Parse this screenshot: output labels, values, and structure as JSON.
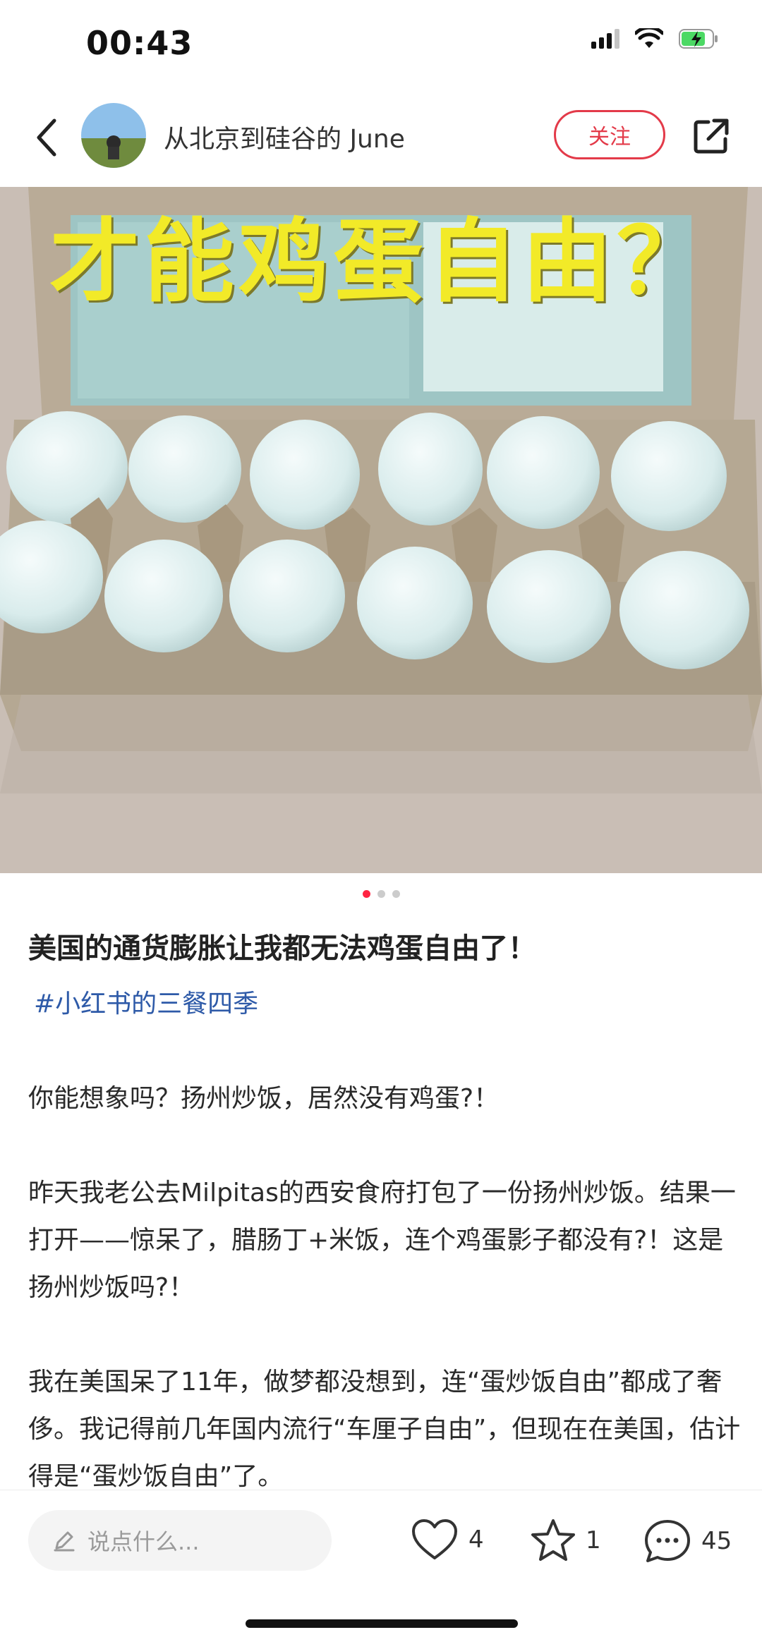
{
  "status": {
    "time": "00:43",
    "icons": [
      "cellular-signal-icon",
      "wifi-icon",
      "battery-charging-icon"
    ]
  },
  "header": {
    "back_icon": "chevron-left-icon",
    "author": "从北京到硅谷的 June",
    "follow_label": "关注",
    "share_icon": "share-icon"
  },
  "photo": {
    "overlay_caption": "才能鸡蛋自由？",
    "carousel_total": 3,
    "carousel_active": 1
  },
  "post": {
    "title": "美国的通货膨胀让我都无法鸡蛋自由了！",
    "tag": "#小红书的三餐四季",
    "paragraphs": [
      "你能想象吗？扬州炒饭，居然没有鸡蛋?！",
      "昨天我老公去Milpitas的西安食府打包了一份扬州炒饭。结果一打开——惊呆了，腊肠丁+米饭，连个鸡蛋影子都没有?！这是扬州炒饭吗?！",
      "我在美国呆了11年，做梦都没想到，连“蛋炒饭自由”都成了奢侈。我记得前几年国内流行“车厘子自由”，但现在在美国，估计得是“蛋炒饭自由”了。"
    ]
  },
  "bottom_bar": {
    "comment_placeholder": "说点什么...",
    "likes": "4",
    "favorites": "1",
    "comments": "45"
  },
  "colors": {
    "accent": "#e33a49",
    "tag": "#2e5aa8",
    "caption": "#f2ea28"
  }
}
